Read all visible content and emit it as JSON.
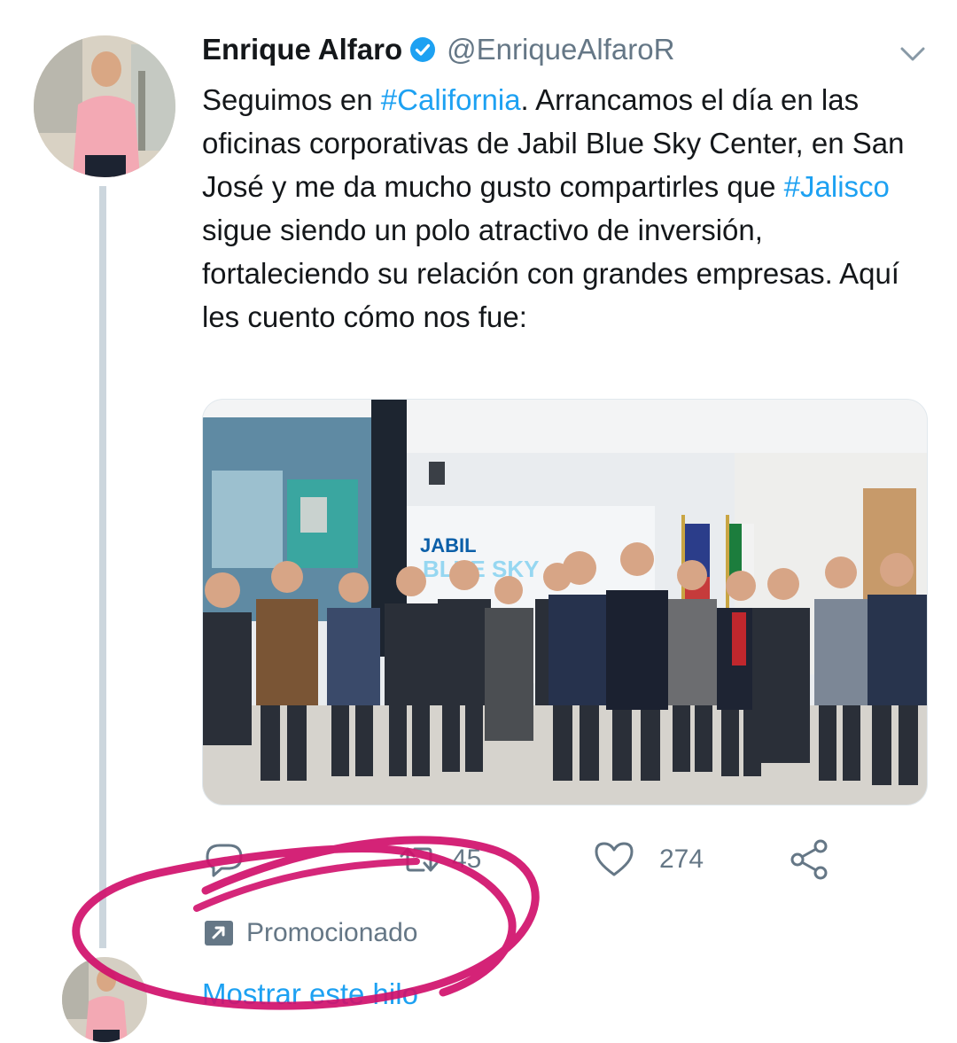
{
  "tweet": {
    "author": {
      "display_name": "Enrique Alfaro",
      "handle": "@EnriqueAlfaroR",
      "verified": true
    },
    "text_parts": {
      "p1": "Seguimos en ",
      "h1": "#California",
      "p2": ". Arrancamos el día en las oficinas corporativas de Jabil Blue Sky Center, en San José y me da mucho gusto compartirles que ",
      "h2": "#Jalisco",
      "p3": " sigue siendo un polo atractivo de inversión, fortaleciendo su relación con grandes empresas. Aquí les cuento cómo nos fue:"
    },
    "photo": {
      "sign_text": "JABIL",
      "sign_text2": "BLUE SKY"
    },
    "actions": {
      "reply_count": "",
      "retweet_count": "45",
      "like_count": "274"
    },
    "promoted_label": "Promocionado",
    "show_thread_label": "Mostrar este hilo"
  },
  "colors": {
    "link": "#1da1f2",
    "secondary_text": "#657786",
    "thread_line": "#ccd6dd",
    "annotation": "#d0106b"
  },
  "icons": [
    "verified-icon",
    "chevron-down-icon",
    "reply-icon",
    "retweet-icon",
    "like-icon",
    "share-icon",
    "promoted-icon"
  ]
}
